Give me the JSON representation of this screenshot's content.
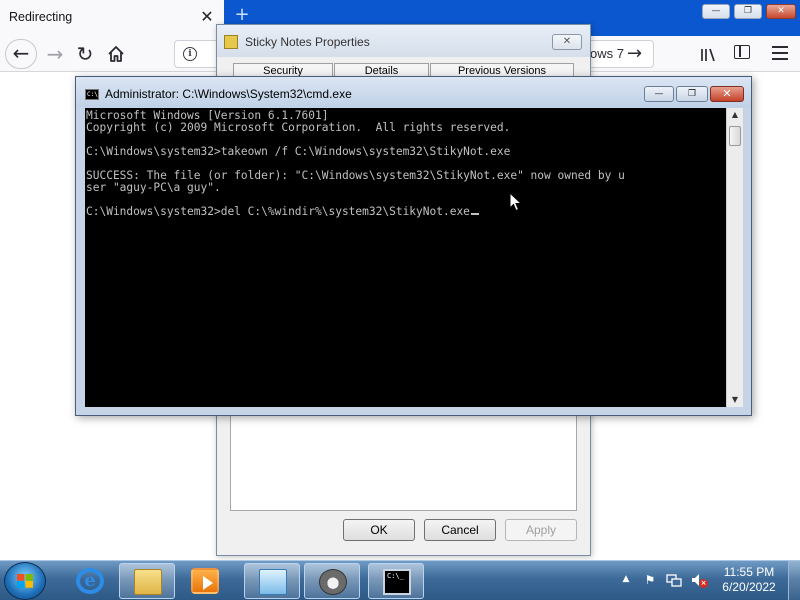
{
  "browser": {
    "tab_title": "Redirecting",
    "tab_close": "✕",
    "new_tab": "+",
    "url_text": "ows 7",
    "window_controls": {
      "minimize": "—",
      "maximize": "❐",
      "close": "✕"
    }
  },
  "properties_dialog": {
    "title": "Sticky Notes Properties",
    "close": "✕",
    "tabs": [
      "Security",
      "Details",
      "Previous Versions"
    ],
    "buttons": {
      "ok": "OK",
      "cancel": "Cancel",
      "apply": "Apply"
    }
  },
  "cmd": {
    "title": "Administrator: C:\\Windows\\System32\\cmd.exe",
    "icon_text": "C:\\",
    "lines": [
      "Microsoft Windows [Version 6.1.7601]",
      "Copyright (c) 2009 Microsoft Corporation.  All rights reserved.",
      "",
      "C:\\Windows\\system32>takeown /f C:\\Windows\\system32\\StikyNot.exe",
      "",
      "SUCCESS: The file (or folder): \"C:\\Windows\\system32\\StikyNot.exe\" now owned by u",
      "ser \"aguy-PC\\a guy\".",
      "",
      "C:\\Windows\\system32>del C:\\%windir%\\system32\\StikyNot.exe"
    ],
    "controls": {
      "minimize": "—",
      "maximize": "❐",
      "close": "✕"
    },
    "scroll": {
      "up": "▲",
      "down": "▼"
    }
  },
  "taskbar": {
    "tray_arrow": "▲",
    "clock": {
      "time": "11:55 PM",
      "date": "6/20/2022"
    },
    "cmd_glyph_text": "C:\\_",
    "ie_glyph_text": "e"
  },
  "colors": {
    "browser_tabstrip": "#0b57d0",
    "console_bg": "#000000",
    "console_text": "#c0c0c0",
    "taskbar": "#3d6a98"
  }
}
